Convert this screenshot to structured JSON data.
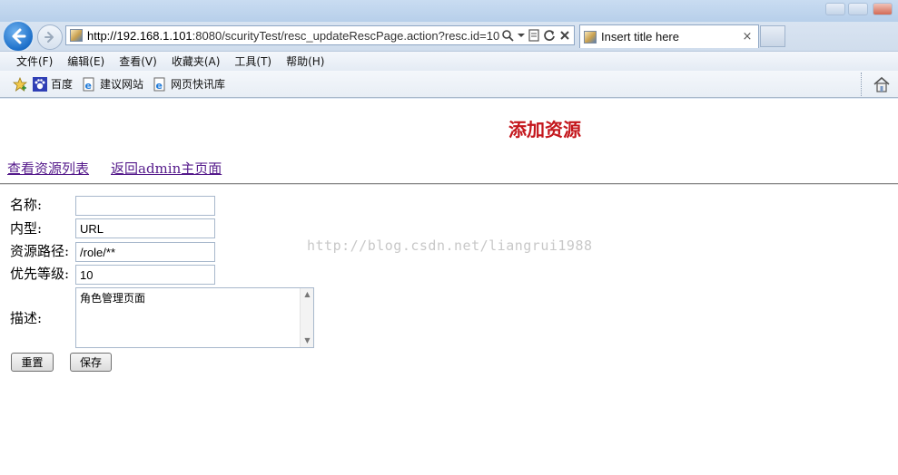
{
  "browser": {
    "address": {
      "host": "http://192.168.1.101",
      "path": ":8080/scurityTest/resc_updateRescPage.action?resc.id=10"
    },
    "tab": {
      "title": "Insert title here",
      "close": "×"
    },
    "menu": [
      "文件(F)",
      "编辑(E)",
      "查看(V)",
      "收藏夹(A)",
      "工具(T)",
      "帮助(H)"
    ],
    "favorites": [
      "百度",
      "建议网站",
      "网页快讯库"
    ]
  },
  "page": {
    "heading": "添加资源",
    "links": {
      "list": "查看资源列表",
      "back": "返回admin主页面"
    },
    "form": {
      "name_label": "名称:",
      "name_value": "",
      "type_label": "内型:",
      "type_value": "URL",
      "path_label": "资源路径:",
      "path_value": "/role/**",
      "priority_label": "优先等级:",
      "priority_value": "10",
      "desc_label": "描述:",
      "desc_value": "角色管理页面",
      "reset_label": "重置",
      "save_label": "保存"
    },
    "watermark": "http://blog.csdn.net/liangrui1988"
  },
  "colors": {
    "heading": "#c4161c",
    "link": "#551a8b",
    "accent": "#1c6fc9"
  }
}
